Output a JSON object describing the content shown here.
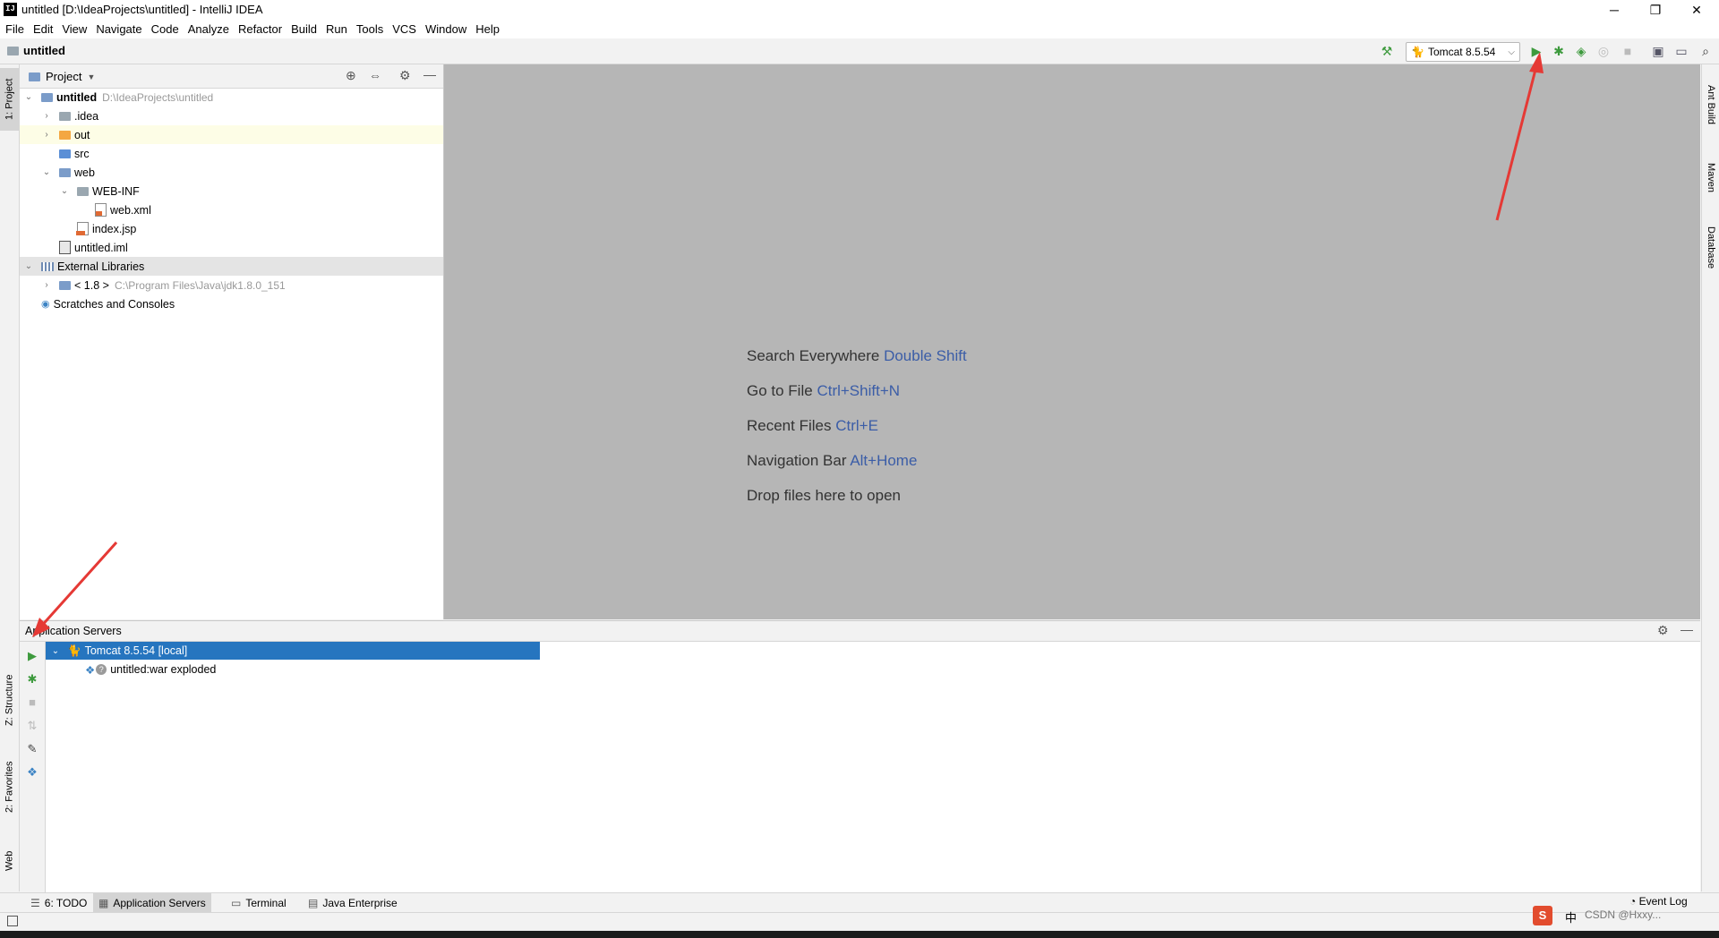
{
  "window": {
    "title": "untitled [D:\\IdeaProjects\\untitled] - IntelliJ IDEA",
    "logo_text": "IJ",
    "minimize": "─",
    "restore": "❐",
    "close": "✕"
  },
  "menu": [
    "File",
    "Edit",
    "View",
    "Navigate",
    "Code",
    "Analyze",
    "Refactor",
    "Build",
    "Run",
    "Tools",
    "VCS",
    "Window",
    "Help"
  ],
  "navbar": {
    "breadcrumb": "untitled",
    "run_config": "Tomcat 8.5.54"
  },
  "project_panel": {
    "title": "Project",
    "tree": [
      {
        "label": "untitled",
        "path": "D:\\IdeaProjects\\untitled",
        "arrow": "⌄",
        "depth": 0,
        "icon": "module-folder-icon",
        "bold": true
      },
      {
        "label": ".idea",
        "arrow": "›",
        "depth": 1,
        "icon": "folder-icon"
      },
      {
        "label": "out",
        "arrow": "›",
        "depth": 1,
        "icon": "excluded-folder-icon",
        "highlight": true
      },
      {
        "label": "src",
        "arrow": "",
        "depth": 1,
        "icon": "source-folder-icon"
      },
      {
        "label": "web",
        "arrow": "⌄",
        "depth": 1,
        "icon": "web-folder-icon"
      },
      {
        "label": "WEB-INF",
        "arrow": "⌄",
        "depth": 2,
        "icon": "folder-icon"
      },
      {
        "label": "web.xml",
        "arrow": "",
        "depth": 3,
        "icon": "xml-file-icon"
      },
      {
        "label": "index.jsp",
        "arrow": "",
        "depth": 2,
        "icon": "jsp-file-icon"
      },
      {
        "label": "untitled.iml",
        "arrow": "",
        "depth": 1,
        "icon": "iml-file-icon"
      },
      {
        "label": "External Libraries",
        "arrow": "⌄",
        "depth": 0,
        "icon": "library-icon",
        "selected_gray": true
      },
      {
        "label": "< 1.8 >",
        "path": "C:\\Program Files\\Java\\jdk1.8.0_151",
        "arrow": "›",
        "depth": 1,
        "icon": "jdk-folder-icon"
      },
      {
        "label": "Scratches and Consoles",
        "arrow": "",
        "depth": 0,
        "icon": "scratches-icon"
      }
    ]
  },
  "editor_hints": [
    {
      "text": "Search Everywhere",
      "key": "Double Shift"
    },
    {
      "text": "Go to File",
      "key": "Ctrl+Shift+N"
    },
    {
      "text": "Recent Files",
      "key": "Ctrl+E"
    },
    {
      "text": "Navigation Bar",
      "key": "Alt+Home"
    },
    {
      "text": "Drop files here to open",
      "key": ""
    }
  ],
  "left_stripe": {
    "project": "1: Project",
    "structure": "Z: Structure",
    "favorites": "2: Favorites",
    "web": "Web"
  },
  "right_stripe": {
    "ant": "Ant Build",
    "maven": "Maven",
    "database": "Database"
  },
  "app_servers": {
    "title": "Application Servers",
    "server": "Tomcat 8.5.54 [local]",
    "artifact": "untitled:war exploded"
  },
  "bottom_tabs": [
    {
      "label": "6: TODO",
      "icon": "☰",
      "active": false
    },
    {
      "label": "Application Servers",
      "icon": "▦",
      "active": true
    },
    {
      "label": "Terminal",
      "icon": "▭",
      "active": false
    },
    {
      "label": "Java Enterprise",
      "icon": "▤",
      "active": false
    }
  ],
  "status": {
    "event_log": "Event Log",
    "ime": "中",
    "watermark": "CSDN @Hxxy..."
  },
  "colors": {
    "selection": "#2675bf",
    "run_green": "#3d9a3d",
    "arrow_red": "#e53935",
    "link_blue": "#3b5da7"
  }
}
